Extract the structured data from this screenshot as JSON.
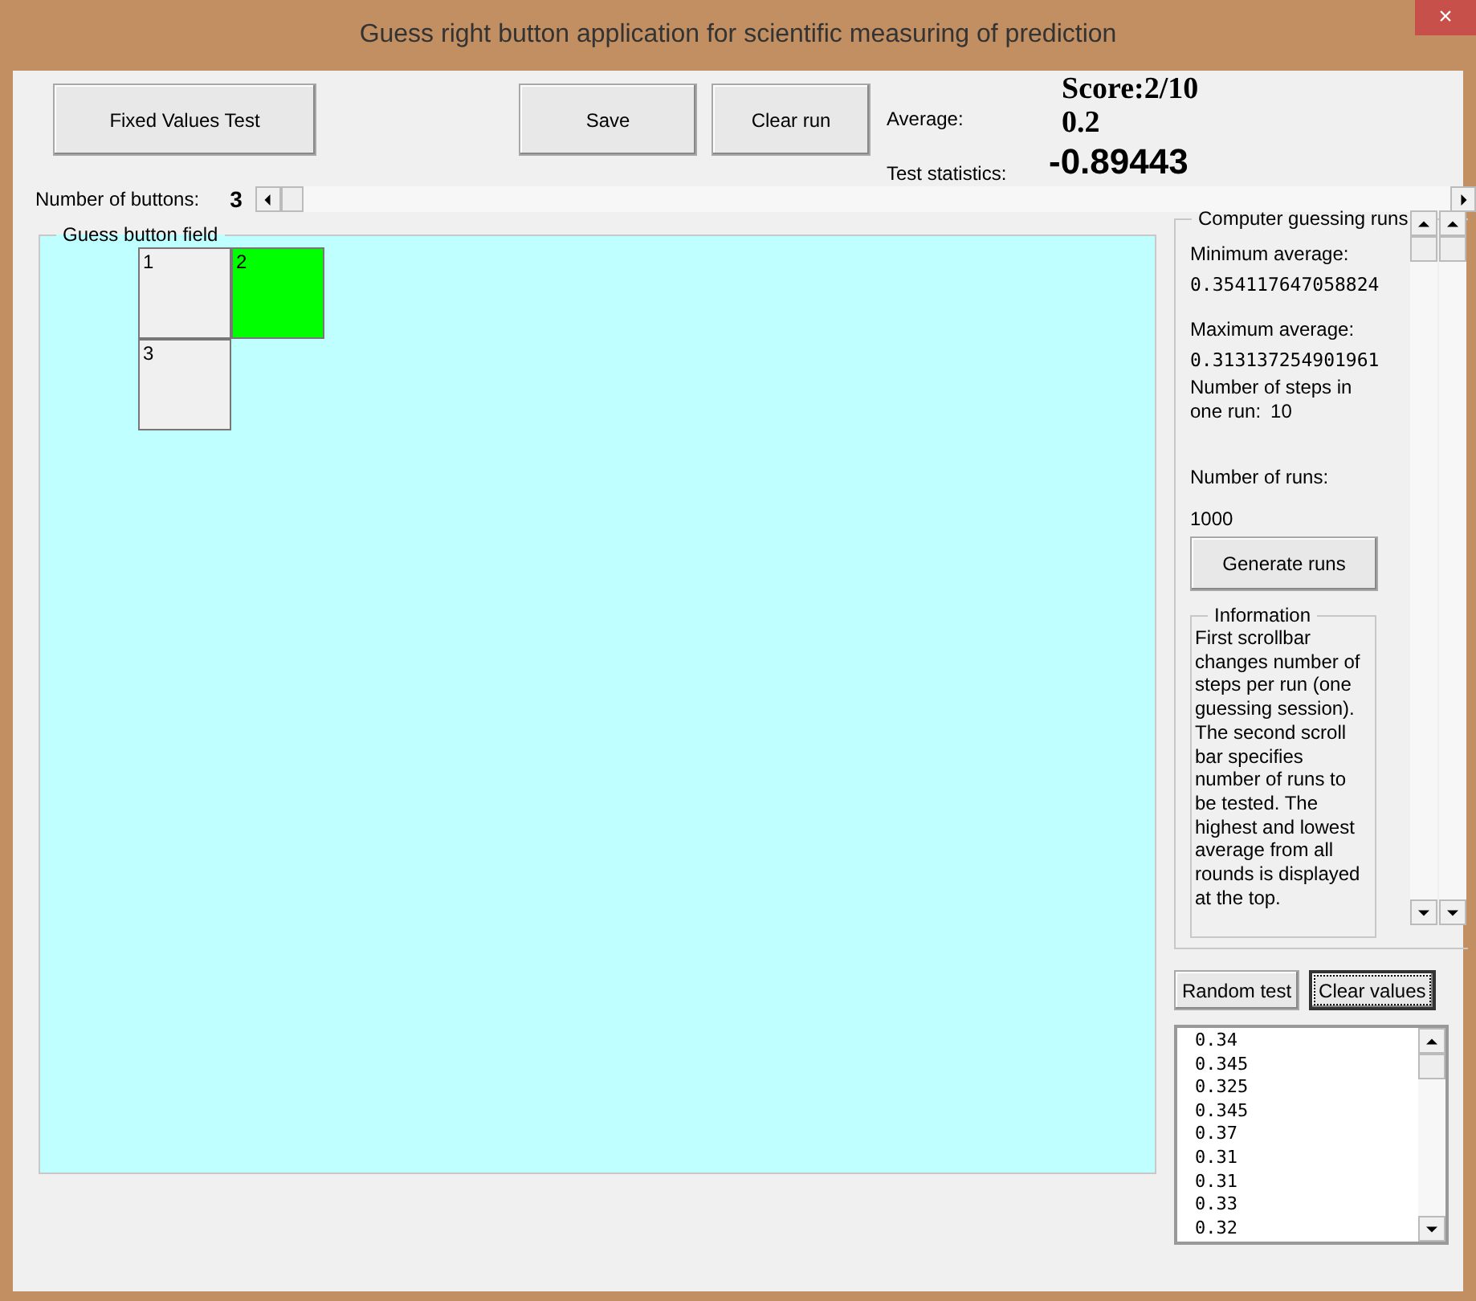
{
  "window": {
    "title": "Guess right button application for scientific measuring of prediction",
    "close": "×"
  },
  "toolbar": {
    "buttons": [
      "Fixed Values Test",
      "Save",
      "Clear run"
    ],
    "average_label": "Average:",
    "score": "Score:2/10",
    "average": "0.2",
    "test_statistics_label": "Test statistics:",
    "test_statistics": "-0.89443"
  },
  "number_of_buttons": {
    "label": "Number of buttons:",
    "value": "3"
  },
  "guess_field": {
    "title": "Guess button field",
    "buttons": [
      {
        "label": "1",
        "selected": false
      },
      {
        "label": "2",
        "selected": true
      },
      {
        "label": "3",
        "selected": false
      }
    ]
  },
  "computer_runs": {
    "title": "Computer guessing runs",
    "minimum_label": "Minimum average:",
    "minimum": "0.354117647058824",
    "maximum_label": "Maximum average:",
    "maximum": "0.313137254901961",
    "steps_label": "Number of steps in one run:",
    "steps": "10",
    "runs_label": "Number of runs:",
    "runs": "1000",
    "generate_button": "Generate runs",
    "information": {
      "title": "Information",
      "text": "First scrollbar changes number of steps per run (one guessing session). The second scroll bar specifies number of runs to be tested. The highest and lowest average from all rounds is displayed at the top."
    }
  },
  "actions": [
    {
      "label": "Random test",
      "focused": false
    },
    {
      "label": "Clear values",
      "focused": true
    }
  ],
  "values": [
    "0.34",
    "0.345",
    "0.325",
    "0.345",
    "0.37",
    "0.31",
    "0.31",
    "0.33",
    "0.32"
  ]
}
